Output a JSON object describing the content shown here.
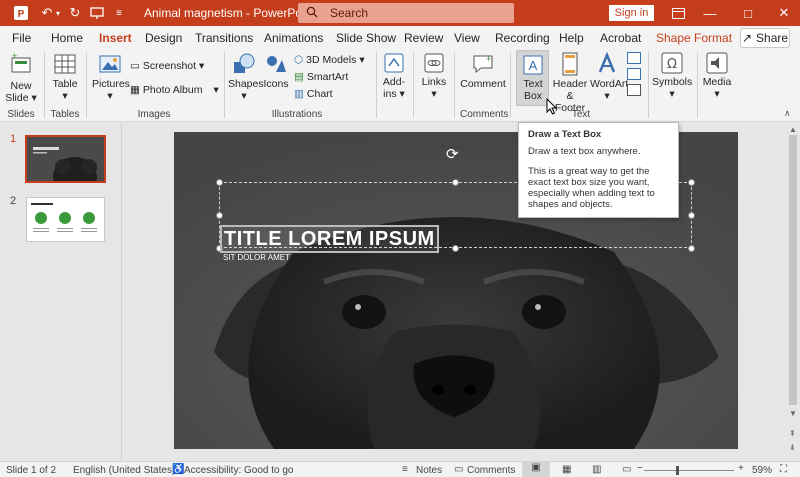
{
  "titlebar": {
    "doc_title": "Animal magnetism",
    "separator": "-",
    "app_name": "PowerPoint",
    "search_placeholder": "Search",
    "signin_label": "Sign in",
    "bg_color": "#c43e1c"
  },
  "tabs": [
    {
      "label": "File"
    },
    {
      "label": "Home"
    },
    {
      "label": "Insert"
    },
    {
      "label": "Design"
    },
    {
      "label": "Transitions"
    },
    {
      "label": "Animations"
    },
    {
      "label": "Slide Show"
    },
    {
      "label": "Review"
    },
    {
      "label": "View"
    },
    {
      "label": "Recording"
    },
    {
      "label": "Help"
    },
    {
      "label": "Acrobat"
    },
    {
      "label": "Shape Format"
    }
  ],
  "share_label": "Share",
  "ribbon": {
    "new_slide": "New",
    "new_slide_2": "Slide",
    "table": "Table",
    "pictures": "Pictures",
    "screenshot": "Screenshot",
    "photo_album": "Photo Album",
    "shapes": "Shapes",
    "icons": "Icons",
    "models_3d": "3D Models",
    "smartart": "SmartArt",
    "chart": "Chart",
    "addins": "Add-",
    "addins_2": "ins",
    "links": "Links",
    "comment": "Comment",
    "text_box": "Text",
    "text_box_2": "Box",
    "header_footer": "Header",
    "header_footer_2": "& Footer",
    "wordart": "WordArt",
    "symbols": "Symbols",
    "media": "Media",
    "groups": {
      "slides": "Slides",
      "tables": "Tables",
      "images": "Images",
      "illustrations": "Illustrations",
      "comments": "Comments",
      "text": "Text"
    }
  },
  "thumbnails": [
    {
      "number": "1"
    },
    {
      "number": "2"
    }
  ],
  "slide": {
    "title": "TITLE LOREM IPSUM",
    "subtitle": "SIT DOLOR AMET"
  },
  "tooltip": {
    "title": "Draw a Text Box",
    "line1": "Draw a text box anywhere.",
    "line2": "This is a great way to get the exact text box size you want, especially when adding text to shapes and objects."
  },
  "status": {
    "slide_info": "Slide 1 of 2",
    "language": "English (United States)",
    "accessibility": "Accessibility: Good to go",
    "notes": "Notes",
    "comments": "Comments",
    "zoom": "59%"
  },
  "colors": {
    "accent": "#c43e1c"
  }
}
